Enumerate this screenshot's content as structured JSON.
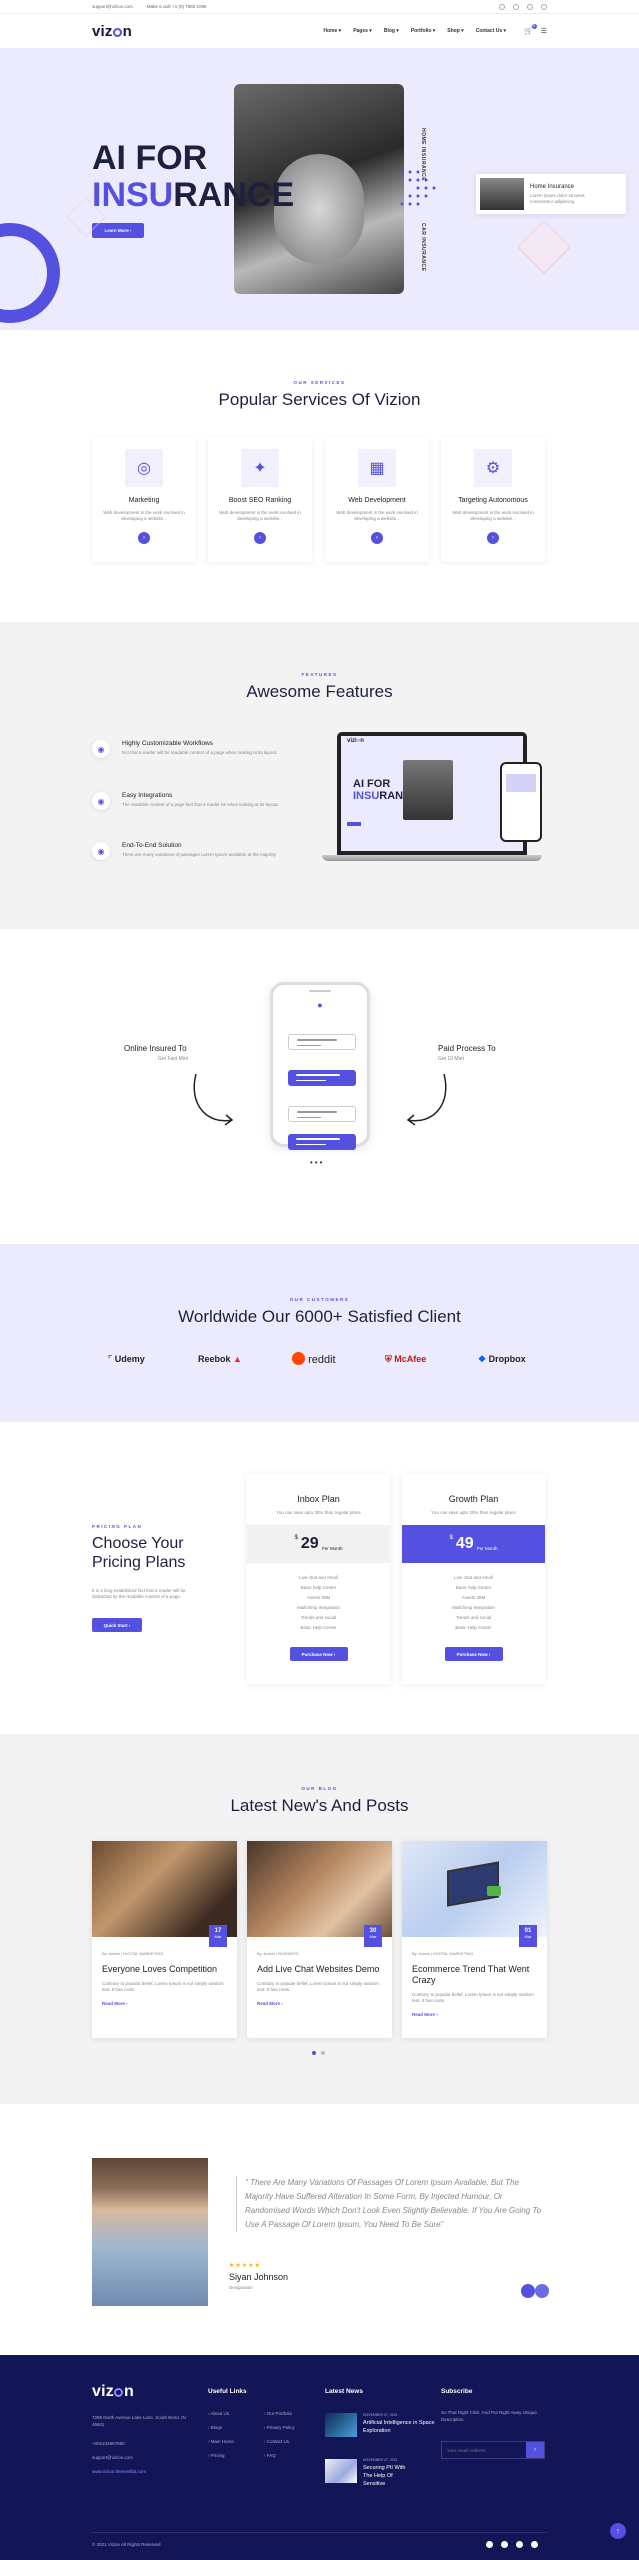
{
  "topbar": {
    "email": "support@vizion.com",
    "phone": "Make a call: +1 (0) 7560 1095"
  },
  "nav": {
    "logo_pre": "viz",
    "logo_post": "n",
    "items": [
      "Home ▾",
      "Pages ▾",
      "Blog ▾",
      "Portfolio ▾",
      "Shop ▾",
      "Contact Us ▾"
    ],
    "cart_count": "0"
  },
  "hero": {
    "line1": "AI FOR",
    "line2_blue": "INSU",
    "line2_rest": "RANCE",
    "button": "Learn More ›",
    "vertical1": "HOME INSURANCE",
    "vertical2": "CAR INSURANCE",
    "card_title": "Home Insurance",
    "card_desc": "Lorem ipsum dolor sit amet, consectetur adipiscing"
  },
  "services": {
    "tag": "OUR SERVICES",
    "title": "Popular Services Of Vizion",
    "items": [
      {
        "icon": "target-icon",
        "title": "Marketing",
        "desc": "Web development is the work involved in developing a website..."
      },
      {
        "icon": "seo-icon",
        "title": "Boost SEO Ranking",
        "desc": "Web development is the work involved in developing a website..."
      },
      {
        "icon": "calendar-icon",
        "title": "Web Development",
        "desc": "Web development is the work involved in developing a website..."
      },
      {
        "icon": "gear-icon",
        "title": "Targeting Autonomous",
        "desc": "Web development is the work involved in developing a website..."
      }
    ]
  },
  "features": {
    "tag": "FEATURES",
    "title": "Awesome Features",
    "items": [
      {
        "title": "Highly Customizable Workflows",
        "desc": "Not that a reader will be readable content of a page when looking at its layout."
      },
      {
        "title": "Easy Integrations",
        "desc": "The readable content of a page fact that a reader be when looking at its layout."
      },
      {
        "title": "End-To-End Solution",
        "desc": "There are many variations of passages Lorem Ipsum available at the majority."
      }
    ]
  },
  "process": {
    "left_title": "Online Insured To",
    "left_sub": "Get Fast Mint",
    "right_title": "Paid Process To",
    "right_sub": "Get 10 Mint"
  },
  "clients": {
    "tag": "OUR CUSTOMERS",
    "title": "Worldwide Our 6000+ Satisfied Client",
    "logos": [
      "Udemy",
      "Reebok",
      "reddit",
      "McAfee",
      "Dropbox"
    ]
  },
  "pricing": {
    "tag": "PRICING PLAN",
    "title": "Choose Your Pricing Plans",
    "desc": "It is a long established fact that a reader will be distracted by the readable content of a page.",
    "button": "Quick Start ›",
    "plans": [
      {
        "name": "Inbox Plan",
        "save": "You can save upto 30% than regular plans",
        "currency": "$",
        "price": "29",
        "per": "Per Month",
        "features": [
          "Live chat and email",
          "Basic help Center",
          "Assets 30M",
          "Mailchimp Integration",
          "Trends and social",
          "Basic Help Center"
        ],
        "button": "Purchase Now ›"
      },
      {
        "name": "Growth Plan",
        "save": "You can save upto 30% than regular plans",
        "currency": "$",
        "price": "49",
        "per": "Per Month",
        "features": [
          "Live chat and email",
          "Basic help Center",
          "Assets 30M",
          "Mailchimp Integration",
          "Trends and social",
          "Basic Help Center"
        ],
        "button": "Purchase Now ›"
      }
    ]
  },
  "blog": {
    "tag": "OUR BLOG",
    "title": "Latest New's And Posts",
    "posts": [
      {
        "day": "17",
        "mon": "Mar",
        "meta": "By: Admin  |  DIGITAL MARKETING",
        "title": "Everyone Loves Competition",
        "desc": "Contrary to popular belief, Lorem Ipsum is not simply random text. It has roots.",
        "more": "Read More ›"
      },
      {
        "day": "30",
        "mon": "Mar",
        "meta": "By: Admin  |  BUSINESS",
        "title": "Add Live Chat Websites Demo",
        "desc": "Contrary to popular belief, Lorem Ipsum is not simply random text. It has roots.",
        "more": "Read More ›"
      },
      {
        "day": "01",
        "mon": "Mar",
        "meta": "By: Admin  |  DIGITAL MARKETING",
        "title": "Ecommerce Trend That Went Crazy",
        "desc": "Contrary to popular belief, Lorem Ipsum is not simply random text. It has roots.",
        "more": "Read More ›"
      }
    ]
  },
  "testimonial": {
    "quote": "\" There Are Many Variations Of Passages Of Lorem Ipsum Available, But The Majority Have Suffered Alteration In Some Form, By Injected Humour, Or Randomised Words Which Don't Look Even Slightly Believable. If You Are Going To Use A Passage Of Lorem Ipsum, You Need To Be Sure\"",
    "stars": "★★★★★",
    "name": "Siyan Johnson",
    "role": "Designation"
  },
  "footer": {
    "address": "7298 North Avenue Lake Lane, South Bend, IN 46601",
    "phone": "+001234567890",
    "email": "support@vizion.com",
    "website": "www.vizion.themesflat.com",
    "links_title": "Useful Links",
    "links_col1": [
      "About Us",
      "Blogs",
      "Main Home",
      "Pricing"
    ],
    "links_col2": [
      "Our Portfolio",
      "Privacy Policy",
      "Contact Us",
      "FAQ"
    ],
    "news_title": "Latest News",
    "news": [
      {
        "date": "NOVEMBER 07, 2021",
        "title": "Artificial Intelligence in Space Exploration"
      },
      {
        "date": "NOVEMBER 07, 2021",
        "title": "Securing PII With The Help Of Sensitive"
      }
    ],
    "sub_title": "Subscribe",
    "sub_desc": "So That Right Click, And Put Right Away Unique Description.",
    "sub_placeholder": "Your email Address",
    "copyright": "© 2021 Vizion All Rights Reserved"
  },
  "colors": {
    "accent": "#5450e0",
    "footer": "#131656",
    "hero_bg": "#ecebfd"
  }
}
